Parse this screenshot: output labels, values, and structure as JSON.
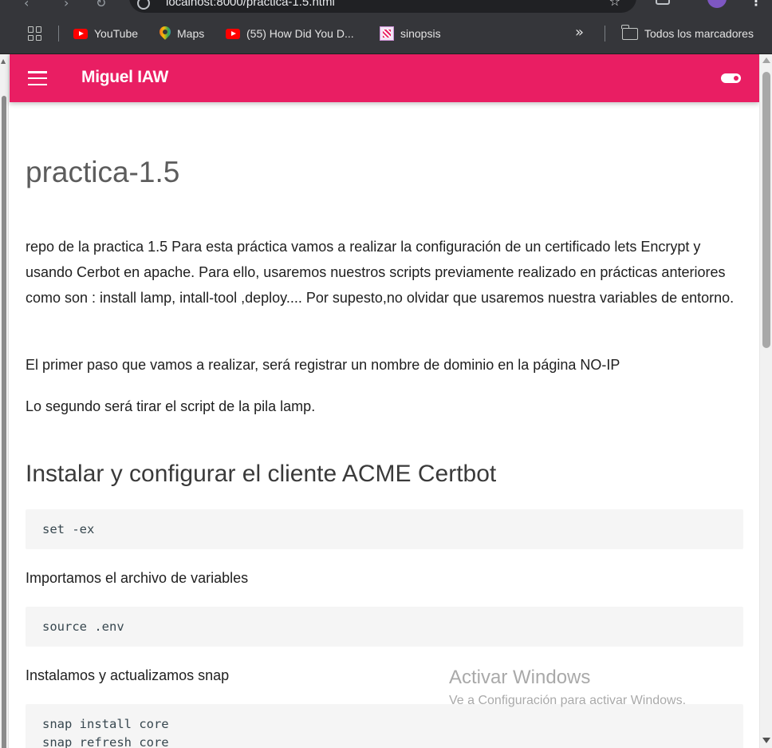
{
  "browser": {
    "url": "localhost:8000/practica-1.5.html",
    "bookmarks": [
      {
        "label": "YouTube"
      },
      {
        "label": "Maps"
      },
      {
        "label": "(55) How Did You D..."
      },
      {
        "label": "sinopsis"
      }
    ],
    "all_bookmarks_label": "Todos los marcadores",
    "more_label": "»"
  },
  "header": {
    "title": "Miguel IAW",
    "brand_color": "#e91e63"
  },
  "page": {
    "title": "practica-1.5",
    "intro": "repo de la practica 1.5 Para esta práctica vamos a realizar la configuración de un certificado lets Encrypt y usando Cerbot en apache. Para ello, usaremos nuestros scripts previamente realizado en prácticas anteriores como son : install lamp, intall-tool ,deploy.... Por supesto,no olvidar que usaremos nuestra variables de entorno.",
    "step1": "El primer paso que vamos a realizar, será registrar un nombre de dominio en la página NO-IP",
    "step2": "Lo segundo será tirar el script de la pila lamp.",
    "section_heading": "Instalar y configurar el cliente ACME Certbot",
    "code1": "set -ex",
    "text_import": "Importamos el archivo de variables",
    "code2": "source .env",
    "text_snap": "Instalamos y actualizamos snap",
    "code3": "snap install core\nsnap refresh core"
  },
  "watermark": {
    "line1": "Activar Windows",
    "line2": "Ve a Configuración para activar Windows."
  }
}
